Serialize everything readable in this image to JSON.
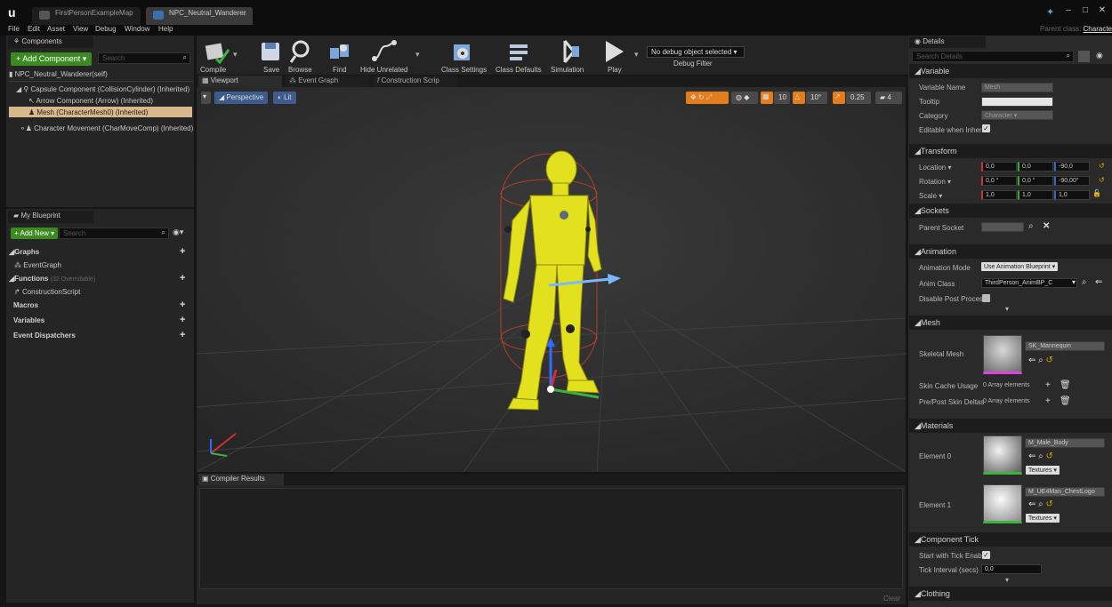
{
  "tabs": [
    {
      "label": "FirstPersonExampleMap"
    },
    {
      "label": "NPC_Neutral_Wanderer"
    }
  ],
  "menu": [
    "File",
    "Edit",
    "Asset",
    "View",
    "Debug",
    "Window",
    "Help"
  ],
  "parent_class": {
    "label": "Parent class:",
    "value": "Characte"
  },
  "components": {
    "title": "Components",
    "add_label": "+ Add Component ▾",
    "search_placeholder": "Search",
    "root": "NPC_Neutral_Wanderer(self)",
    "tree": [
      "Capsule Component (CollisionCylinder) (Inherited)",
      "Arrow Component (Arrow) (Inherited)",
      "Mesh (CharacterMesh0) (Inherited)",
      "Character Movement (CharMoveComp) (Inherited)"
    ]
  },
  "my_blueprint": {
    "title": "My Blueprint",
    "add_label": "+ Add New ▾",
    "search_placeholder": "Search",
    "graphs_label": "Graphs",
    "event_graph": "EventGraph",
    "functions_label": "Functions",
    "functions_note": "(32 Overridable)",
    "construction_script": "ConstructionScript",
    "macros": "Macros",
    "variables": "Variables",
    "dispatchers": "Event Dispatchers"
  },
  "toolbar": {
    "compile": "Compile",
    "save": "Save",
    "browse": "Browse",
    "find": "Find",
    "hide_unrelated": "Hide Unrelated",
    "class_settings": "Class Settings",
    "class_defaults": "Class Defaults",
    "simulation": "Simulation",
    "play": "Play",
    "debug_select": "No debug object selected ▾",
    "debug_filter": "Debug Filter"
  },
  "editor_tabs": [
    "Viewport",
    "Event Graph",
    "Construction Scrip"
  ],
  "viewport": {
    "perspective": "Perspective",
    "lit": "Lit",
    "grid_snap": "10",
    "rot_snap": "10°",
    "scale_snap": "0.25",
    "cam_speed": "4"
  },
  "compiler": {
    "title": "Compiler Results",
    "clear": "Clear"
  },
  "details": {
    "title": "Details",
    "search_placeholder": "Search Details",
    "variable": {
      "header": "Variable",
      "name_label": "Variable Name",
      "name_value": "Mesh",
      "tooltip_label": "Tooltip",
      "category_label": "Category",
      "category_value": "Character",
      "editable_label": "Editable when Inherit"
    },
    "transform": {
      "header": "Transform",
      "location_label": "Location ▾",
      "location": [
        "0,0",
        "0,0",
        "-90,0"
      ],
      "rotation_label": "Rotation ▾",
      "rotation": [
        "0,0 °",
        "0,0 °",
        "-90,00°"
      ],
      "scale_label": "Scale ▾",
      "scale": [
        "1,0",
        "1,0",
        "1,0"
      ]
    },
    "sockets": {
      "header": "Sockets",
      "parent_socket_label": "Parent Socket"
    },
    "animation": {
      "header": "Animation",
      "mode_label": "Animation Mode",
      "mode_value": "Use Animation Blueprint ▾",
      "class_label": "Anim Class",
      "class_value": "ThirdPerson_AnimBP_C",
      "disable_label": "Disable Post Proces"
    },
    "mesh": {
      "header": "Mesh",
      "skeletal_label": "Skeletal Mesh",
      "skeletal_value": "SK_Mannequin",
      "skin_cache_label": "Skin Cache Usage",
      "skin_cache_value": "0 Array elements",
      "prepost_label": "Pre/Post Skin Deltas",
      "prepost_value": "0 Array elements"
    },
    "materials": {
      "header": "Materials",
      "el0_label": "Element 0",
      "el0_value": "M_Male_Body",
      "el1_label": "Element 1",
      "el1_value": "M_UE4Man_ChestLogo",
      "textures": "Textures ▾"
    },
    "tick": {
      "header": "Component Tick",
      "start_label": "Start with Tick Enab",
      "interval_label": "Tick Interval (secs)",
      "interval_value": "0,0"
    },
    "clothing": {
      "header": "Clothing"
    }
  },
  "colors": {
    "accent_green": "#3b8a22",
    "selected_row": "#d8b88a",
    "mannequin": "#e3e01d"
  }
}
